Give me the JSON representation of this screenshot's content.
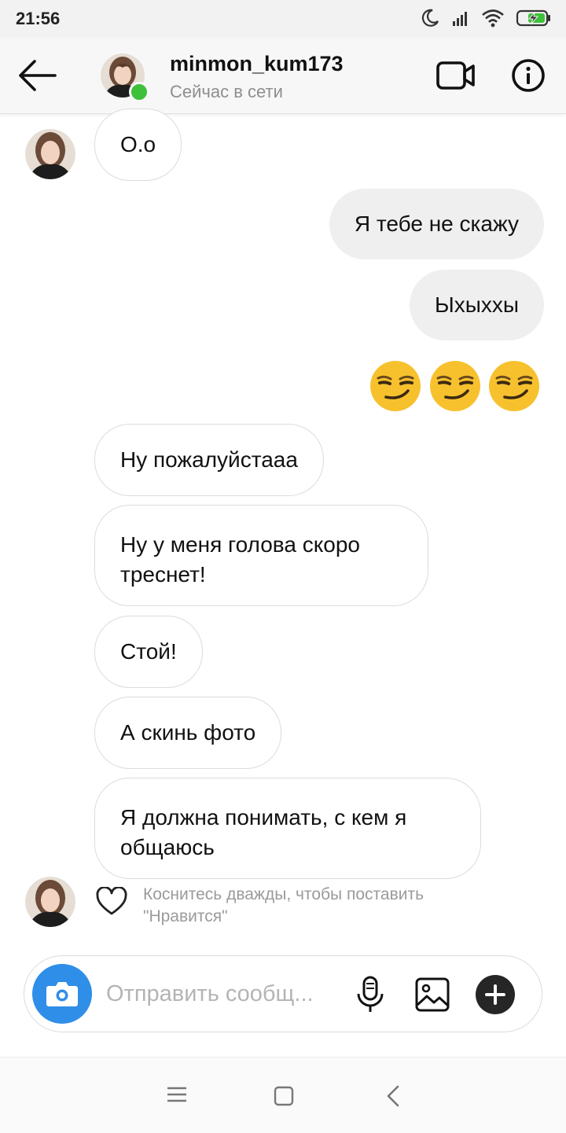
{
  "status_bar": {
    "time": "21:56"
  },
  "header": {
    "username": "minmon_kum173",
    "status": "Сейчас в сети"
  },
  "messages": {
    "m1": "O.o",
    "m2": "Я тебе не скажу",
    "m3": "Ыхыххы",
    "m5": "Ну пожалуйстааа",
    "m6": "Ну у меня голова скоро треснет!",
    "m7": "Стой!",
    "m8": "А скинь фото",
    "m9": "Я должна понимать, с кем я общаюсь"
  },
  "emoji_message": {
    "icons": [
      "smirking-face-emoji",
      "smirking-face-emoji",
      "smirking-face-emoji"
    ]
  },
  "like_hint": "Коснитесь дважды, чтобы поставить \"Нравится\"",
  "composer": {
    "placeholder": "Отправить сообщ..."
  },
  "colors": {
    "online": "#3fc03a",
    "camera_button": "#2f8ee8",
    "outgoing_bubble": "#efefef",
    "plus_button": "#262626"
  }
}
